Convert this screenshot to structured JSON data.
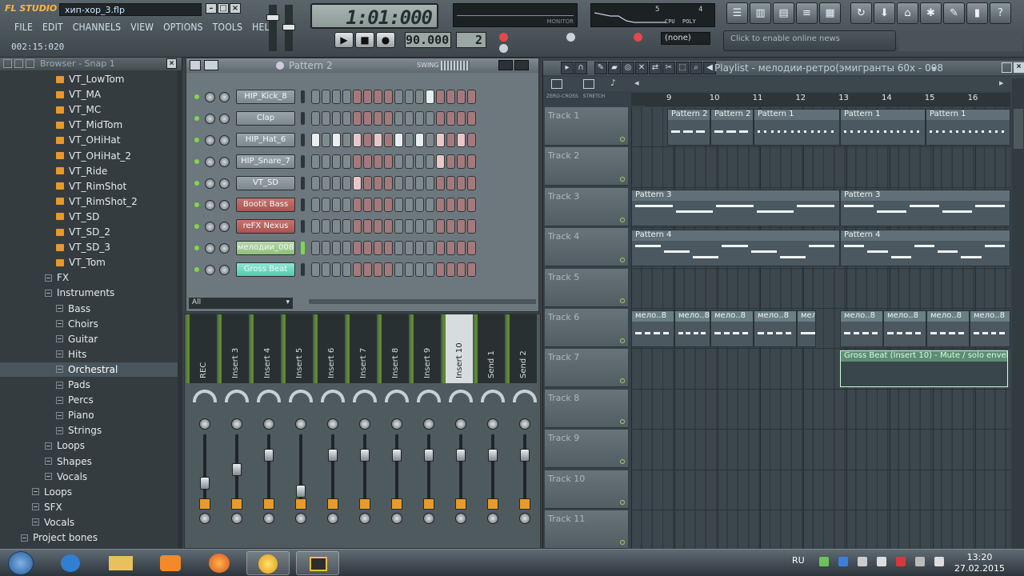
{
  "app": {
    "logo": "FL STUDIO",
    "filename": "хип-хор_3.flp",
    "menu": [
      "FILE",
      "EDIT",
      "CHANNELS",
      "VIEW",
      "OPTIONS",
      "TOOLS",
      "HELP"
    ],
    "time_info": "002:15:020",
    "song_position": "1:01:000",
    "tempo": "90.000",
    "pattern_number": "2",
    "pattern_selector": "(none)",
    "online_news": "Click to enable online news",
    "monitor_label": "MONITOR",
    "cpu_label": "CPU",
    "poly_label": "POLY",
    "ram_value": "5",
    "cpu_value": "4"
  },
  "browser": {
    "title": "Browser - Snap 1",
    "items": [
      {
        "label": "VT_LowTom",
        "kind": "file",
        "indent": 2
      },
      {
        "label": "VT_MA",
        "kind": "file",
        "indent": 2
      },
      {
        "label": "VT_MC",
        "kind": "file",
        "indent": 2
      },
      {
        "label": "VT_MidTom",
        "kind": "file",
        "indent": 2
      },
      {
        "label": "VT_OHiHat",
        "kind": "file",
        "indent": 2
      },
      {
        "label": "VT_OHiHat_2",
        "kind": "file",
        "indent": 2
      },
      {
        "label": "VT_Ride",
        "kind": "file",
        "indent": 2
      },
      {
        "label": "VT_RimShot",
        "kind": "file",
        "indent": 2
      },
      {
        "label": "VT_RimShot_2",
        "kind": "file",
        "indent": 2
      },
      {
        "label": "VT_SD",
        "kind": "file",
        "indent": 2
      },
      {
        "label": "VT_SD_2",
        "kind": "file",
        "indent": 2
      },
      {
        "label": "VT_SD_3",
        "kind": "file",
        "indent": 2
      },
      {
        "label": "VT_Tom",
        "kind": "file",
        "indent": 2
      },
      {
        "label": "FX",
        "kind": "folder",
        "indent": 1
      },
      {
        "label": "Instruments",
        "kind": "folder",
        "indent": 1
      },
      {
        "label": "Bass",
        "kind": "folder",
        "indent": 2
      },
      {
        "label": "Choirs",
        "kind": "folder",
        "indent": 2
      },
      {
        "label": "Guitar",
        "kind": "folder",
        "indent": 2
      },
      {
        "label": "Hits",
        "kind": "folder",
        "indent": 2
      },
      {
        "label": "Orchestral",
        "kind": "folder",
        "indent": 2,
        "selected": true
      },
      {
        "label": "Pads",
        "kind": "folder",
        "indent": 2
      },
      {
        "label": "Percs",
        "kind": "folder",
        "indent": 2
      },
      {
        "label": "Piano",
        "kind": "folder",
        "indent": 2
      },
      {
        "label": "Strings",
        "kind": "folder",
        "indent": 2
      },
      {
        "label": "Loops",
        "kind": "folder",
        "indent": 1
      },
      {
        "label": "Shapes",
        "kind": "folder",
        "indent": 1
      },
      {
        "label": "Vocals",
        "kind": "folder",
        "indent": 1
      },
      {
        "label": "Loops",
        "kind": "folder",
        "indent": 0
      },
      {
        "label": "SFX",
        "kind": "folder",
        "indent": 0
      },
      {
        "label": "Vocals",
        "kind": "folder",
        "indent": 0
      },
      {
        "label": "Project bones",
        "kind": "folder",
        "indent": -1
      }
    ]
  },
  "channel_rack": {
    "title": "Pattern 2",
    "swing_label": "SWING",
    "filter": "All",
    "channels": [
      {
        "name": "HIP_Kick_8",
        "style": "normal",
        "steps": [
          0,
          0,
          0,
          0,
          0,
          0,
          0,
          0,
          0,
          0,
          0,
          1,
          0,
          0,
          0,
          0
        ]
      },
      {
        "name": "Clap",
        "style": "normal",
        "steps": [
          0,
          0,
          0,
          0,
          0,
          0,
          0,
          0,
          0,
          0,
          0,
          0,
          0,
          0,
          0,
          0
        ]
      },
      {
        "name": "HIP_Hat_6",
        "style": "normal",
        "steps": [
          1,
          0,
          1,
          0,
          1,
          0,
          1,
          0,
          1,
          0,
          1,
          0,
          1,
          0,
          1,
          0
        ]
      },
      {
        "name": "HIP_Snare_7",
        "style": "normal",
        "steps": [
          0,
          0,
          0,
          0,
          0,
          0,
          0,
          0,
          0,
          0,
          0,
          0,
          1,
          0,
          0,
          0
        ]
      },
      {
        "name": "VT_SD",
        "style": "normal",
        "steps": [
          0,
          0,
          0,
          0,
          1,
          0,
          0,
          0,
          0,
          0,
          0,
          0,
          0,
          0,
          0,
          0
        ]
      },
      {
        "name": "Bootit Bass",
        "style": "red",
        "steps": [
          0,
          0,
          0,
          0,
          0,
          0,
          0,
          0,
          0,
          0,
          0,
          0,
          0,
          0,
          0,
          0
        ]
      },
      {
        "name": "reFX Nexus",
        "style": "red",
        "steps": [
          0,
          0,
          0,
          0,
          0,
          0,
          0,
          0,
          0,
          0,
          0,
          0,
          0,
          0,
          0,
          0
        ]
      },
      {
        "name": "мелодии_008",
        "style": "green",
        "steps": [
          0,
          0,
          0,
          0,
          0,
          0,
          0,
          0,
          0,
          0,
          0,
          0,
          0,
          0,
          0,
          0
        ]
      },
      {
        "name": "Gross Beat",
        "style": "teal",
        "steps": [
          0,
          0,
          0,
          0,
          0,
          0,
          0,
          0,
          0,
          0,
          0,
          0,
          0,
          0,
          0,
          0
        ]
      }
    ]
  },
  "mixer": {
    "tracks": [
      {
        "label": "REC",
        "level": 0.55,
        "selected": false
      },
      {
        "label": "Insert 3",
        "level": 0.72,
        "selected": false
      },
      {
        "label": "Insert 4",
        "level": 0.9,
        "selected": false
      },
      {
        "label": "Insert 5",
        "level": 0.45,
        "selected": false
      },
      {
        "label": "Insert 6",
        "level": 0.9,
        "selected": false
      },
      {
        "label": "Insert 7",
        "level": 0.9,
        "selected": false
      },
      {
        "label": "Insert 8",
        "level": 0.9,
        "selected": false
      },
      {
        "label": "Insert 9",
        "level": 0.9,
        "selected": false
      },
      {
        "label": "Insert 10",
        "level": 0.9,
        "selected": true
      },
      {
        "label": "Send 1",
        "level": 0.9,
        "selected": false
      },
      {
        "label": "Send 2",
        "level": 0.9,
        "selected": false
      }
    ]
  },
  "playlist": {
    "title": "Playlist - мелодии-ретро(эмигранты 60х - 008",
    "ruler": [
      "9",
      "10",
      "11",
      "12",
      "13",
      "14",
      "15",
      "16"
    ],
    "tracks": [
      "Track 1",
      "Track 2",
      "Track 3",
      "Track 4",
      "Track 5",
      "Track 6",
      "Track 7",
      "Track 8",
      "Track 9",
      "Track 10",
      "Track 11"
    ],
    "clip_names": {
      "p1": "Pattern 1",
      "p2": "Pattern 2",
      "p3": "Pattern 3",
      "p4": "Pattern 4",
      "mel": "мело..8",
      "env": "Gross Beat (Insert 10) - Mute / solo envelope"
    },
    "buttons": {
      "zero_cross": "ZERO-CROSS",
      "stretch": "STRETCH"
    }
  },
  "taskbar": {
    "lang": "RU",
    "time": "13:20",
    "date": "27.02.2015"
  },
  "colors": {
    "accent": "#e8992a",
    "led": "#7fd84a",
    "selected_step": "#e9eef0"
  }
}
